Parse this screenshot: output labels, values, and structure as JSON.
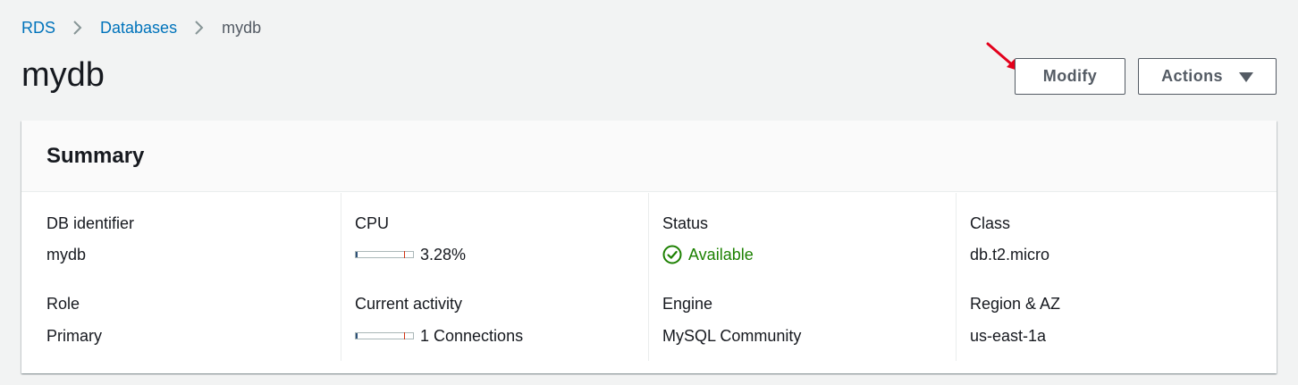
{
  "breadcrumb": {
    "items": [
      "RDS",
      "Databases",
      "mydb"
    ]
  },
  "page": {
    "title": "mydb"
  },
  "toolbar": {
    "modify_label": "Modify",
    "actions_label": "Actions"
  },
  "summary": {
    "title": "Summary",
    "columns": [
      {
        "fields": [
          {
            "label": "DB identifier",
            "value": "mydb"
          },
          {
            "label": "Role",
            "value": "Primary"
          }
        ]
      },
      {
        "fields": [
          {
            "label": "CPU",
            "value": "3.28%",
            "meter_fraction": 0.0328
          },
          {
            "label": "Current activity",
            "value": "1 Connections",
            "meter_fraction": 0.01
          }
        ]
      },
      {
        "fields": [
          {
            "label": "Status",
            "value": "Available",
            "icon": "check-circle-icon"
          },
          {
            "label": "Engine",
            "value": "MySQL Community"
          }
        ]
      },
      {
        "fields": [
          {
            "label": "Class",
            "value": "db.t2.micro"
          },
          {
            "label": "Region & AZ",
            "value": "us-east-1a"
          }
        ]
      }
    ]
  },
  "colors": {
    "link": "#0073bb",
    "status_available": "#1d8102",
    "annotation_arrow": "#e3001b",
    "meter_fill": "#2e5077",
    "meter_threshold": "#d13212"
  }
}
